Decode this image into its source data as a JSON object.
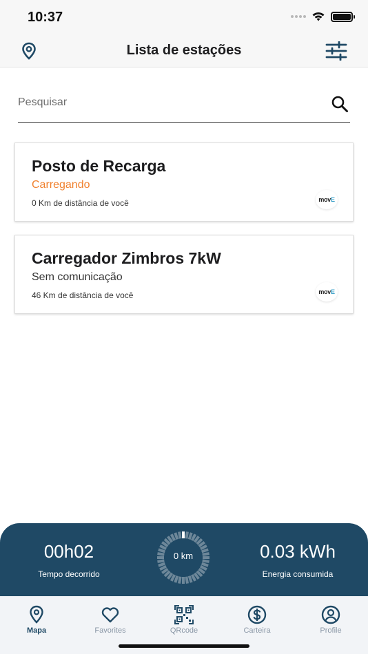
{
  "status_bar": {
    "time": "10:37"
  },
  "header": {
    "title": "Lista de estações"
  },
  "search": {
    "placeholder": "Pesquisar"
  },
  "stations": [
    {
      "name": "Posto de Recarga",
      "status": "Carregando",
      "status_color": "#f07f2b",
      "distance": "0 Km de distância de você",
      "logo": "mov",
      "logo_accent": "E"
    },
    {
      "name": "Carregador Zimbros 7kW",
      "status": "Sem comunicação",
      "status_color": "#333333",
      "distance": "46 Km de distância de você",
      "logo": "mov",
      "logo_accent": "E"
    }
  ],
  "charging": {
    "elapsed_value": "00h02",
    "elapsed_label": "Tempo decorrido",
    "distance_value": "0 km",
    "progress_fraction": 0.02,
    "energy_value": "0.03 kWh",
    "energy_label": "Energia consumida"
  },
  "nav": [
    {
      "label": "Mapa",
      "icon": "map-pin-icon",
      "active": true
    },
    {
      "label": "Favorites",
      "icon": "heart-icon",
      "active": false
    },
    {
      "label": "QRcode",
      "icon": "qrcode-icon",
      "active": false
    },
    {
      "label": "Carteira",
      "icon": "dollar-icon",
      "active": false
    },
    {
      "label": "Profile",
      "icon": "profile-icon",
      "active": false
    }
  ],
  "colors": {
    "primary": "#1f4965",
    "accent_orange": "#f07f2b",
    "inactive_nav": "#8a97a6"
  }
}
